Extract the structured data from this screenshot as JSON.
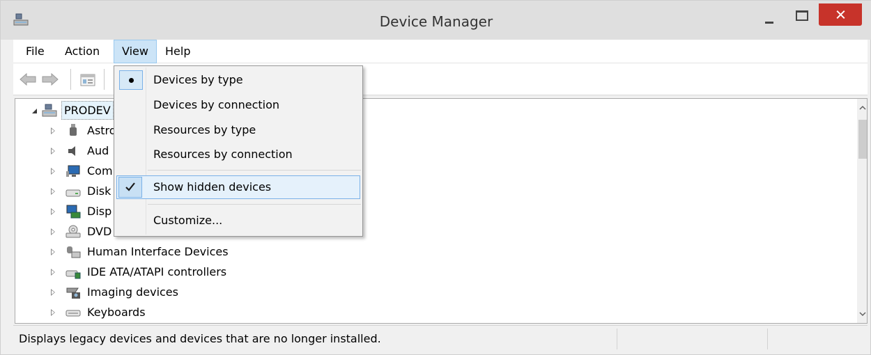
{
  "window": {
    "title": "Device Manager"
  },
  "menu": {
    "file": "File",
    "action": "Action",
    "view": "View",
    "help": "Help"
  },
  "view_menu": {
    "items": [
      {
        "label": "Devices by type",
        "marker": "bullet"
      },
      {
        "label": "Devices by connection",
        "marker": ""
      },
      {
        "label": "Resources by type",
        "marker": ""
      },
      {
        "label": "Resources by connection",
        "marker": ""
      },
      {
        "label": "Show hidden devices",
        "marker": "check"
      },
      {
        "label": "Customize...",
        "marker": ""
      }
    ]
  },
  "tree": {
    "root": {
      "label": "PRODEV",
      "icon": "computer-icon"
    },
    "children": [
      {
        "label": "Astro",
        "icon": "usb-icon"
      },
      {
        "label": "Aud",
        "icon": "speaker-icon"
      },
      {
        "label": "Com",
        "icon": "monitor-icon"
      },
      {
        "label": "Disk",
        "icon": "disk-drive-icon"
      },
      {
        "label": "Disp",
        "icon": "display-adapter-icon"
      },
      {
        "label": "DVD",
        "icon": "dvd-drive-icon"
      },
      {
        "label": "Human Interface Devices",
        "icon": "hid-icon"
      },
      {
        "label": "IDE ATA/ATAPI controllers",
        "icon": "ide-controller-icon"
      },
      {
        "label": "Imaging devices",
        "icon": "camera-icon"
      },
      {
        "label": "Keyboards",
        "icon": "keyboard-icon"
      }
    ]
  },
  "status": {
    "text": "Displays legacy devices and devices that are no longer installed."
  },
  "colors": {
    "accent": "#cce4f7",
    "close_button": "#c7332a"
  }
}
